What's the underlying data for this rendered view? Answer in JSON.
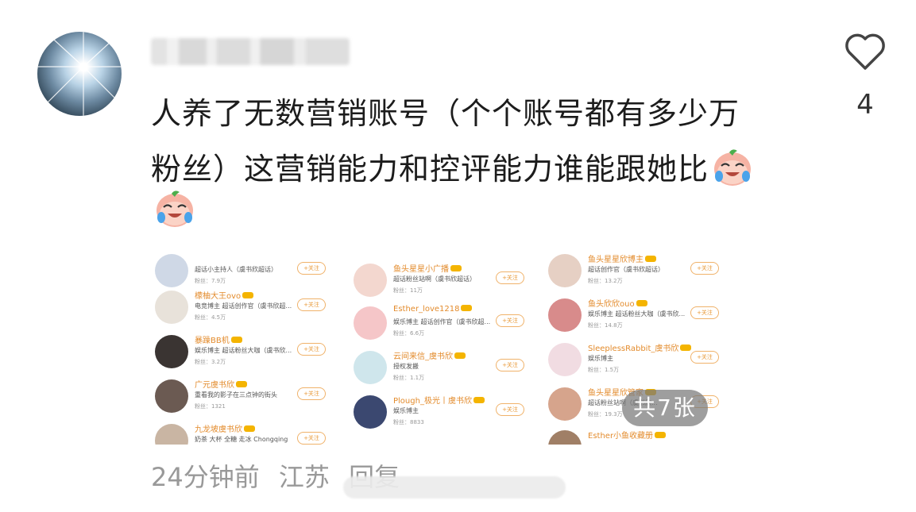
{
  "comment": {
    "username_obscured": true,
    "text_line1": "人养了无数营销账号（个个账号都有多少万",
    "text_line2": "粉丝）这营销能力和控评能力谁能跟她比",
    "emoji_name": "crying-laughing-emoji"
  },
  "like": {
    "count": "4",
    "icon": "heart-outline-icon"
  },
  "gallery": {
    "count_label": "共7张",
    "columns": [
      {
        "rows": [
          {
            "name": "",
            "desc": "超话小主持人（虞书欣超话）",
            "fans": "粉丝：7.9万",
            "follow": "+关注",
            "avatar": "#cfd8e6"
          },
          {
            "name": "檬柚大王ovo",
            "desc": "电竞博主 超话创作官（虞书欣超...",
            "fans": "粉丝：4.5万",
            "follow": "+关注",
            "avatar": "#e8e2da"
          },
          {
            "name": "暴躁BB机",
            "desc": "娱乐博主 超话粉丝大咖（虞书欣...",
            "fans": "粉丝：3.2万",
            "follow": "+关注",
            "avatar": "#3a3432"
          },
          {
            "name": "广元虞书欣",
            "desc": "重看我的影子在三点钟的街头",
            "fans": "粉丝：1321",
            "follow": "+关注",
            "avatar": "#6b5a52"
          },
          {
            "name": "九龙坡虞书欣",
            "desc": "奶茶 大杯 全糖 走冰 Chongqing",
            "fans": "",
            "follow": "+关注",
            "avatar": "#c9b5a3"
          }
        ]
      },
      {
        "rows": [
          {
            "name": "鱼头星星小广播",
            "desc": "超话粉丝站啊（虞书欣超话）",
            "fans": "粉丝：11万",
            "follow": "+关注",
            "avatar": "#f3d7cf"
          },
          {
            "name": "Esther_love1218",
            "desc": "娱乐博主 超话创作官（虞书欣超...",
            "fans": "粉丝：6.6万",
            "follow": "+关注",
            "avatar": "#f5c6c8"
          },
          {
            "name": "云间来信_虞书欣",
            "desc": "授权发搬",
            "fans": "粉丝：1.1万",
            "follow": "+关注",
            "avatar": "#cfe6ec"
          },
          {
            "name": "Plough_极光丨虞书欣",
            "desc": "娱乐博主",
            "fans": "粉丝：8833",
            "follow": "+关注",
            "avatar": "#3b4870"
          }
        ]
      },
      {
        "rows": [
          {
            "name": "鱼头星星欣博主",
            "desc": "超话创作官（虞书欣超话）",
            "fans": "粉丝：13.2万",
            "follow": "+关注",
            "avatar": "#e6d0c4"
          },
          {
            "name": "鱼头欣欣ouo",
            "desc": "娱乐博主 超话粉丝大咖（虞书欣...",
            "fans": "粉丝：14.8万",
            "follow": "+关注",
            "avatar": "#d88b8b"
          },
          {
            "name": "SleeplessRabbit_虞书欣",
            "desc": "娱乐博主",
            "fans": "粉丝：1.5万",
            "follow": "+关注",
            "avatar": "#f1dce2"
          },
          {
            "name": "鱼头星星欣管家",
            "desc": "超话粉丝站啊（虞书欣...",
            "fans": "粉丝：19.3万",
            "follow": "+关注",
            "avatar": "#d6a48c"
          },
          {
            "name": "Esther小鱼收藏册",
            "desc": "",
            "fans": "",
            "follow": "",
            "avatar": "#a07f66"
          }
        ]
      }
    ]
  },
  "meta": {
    "time": "24分钟前",
    "location": "江苏",
    "reply_label": "回复"
  }
}
